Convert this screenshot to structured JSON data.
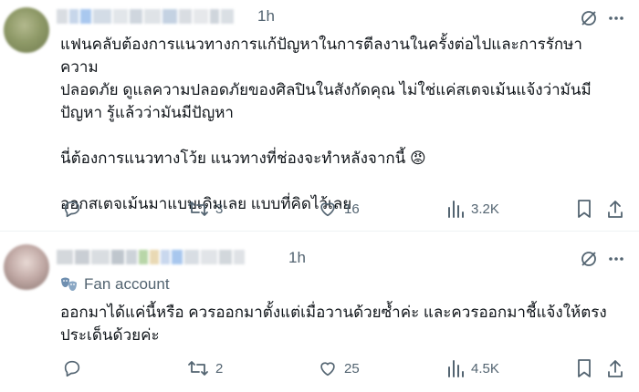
{
  "tweets": [
    {
      "time": "1h",
      "text": "แฟนคลับต้องการแนวทางการแก้ปัญหาในการตีลงานในครั้งต่อไปและการรักษาความ\nปลอดภัย ดูแลความปลอดภัยของศิลปินในสังกัดคุณ ไม่ใช่แค่สเตจเม้นแจ้งว่ามันมี\nปัญหา รู้แล้วว่ามันมีปัญหา\n\nนี่ต้องการแนวทางโว้ย แนวทางที่ช่องจะทำหลังจากนี้ 😡\n\nออกสเตจเม้นมาแบบเดิมเลย แบบที่คิดไว้เลย",
      "stats": {
        "replies": "",
        "reposts": "3",
        "likes": "16",
        "views": "3.2K"
      }
    },
    {
      "time": "1h",
      "badge": "Fan account",
      "text": "ออกมาได้แค่นี้หรือ ควรออกมาตั้งแต่เมื่อวานด้วยซ้ำค่ะ และควรออกมาชี้แจ้งให้ตรง\nประเด็นด้วยค่ะ",
      "stats": {
        "replies": "",
        "reposts": "2",
        "likes": "25",
        "views": "4.5K"
      }
    }
  ],
  "icons": [
    "grok-icon",
    "more-icon",
    "reply-icon",
    "repost-icon",
    "like-icon",
    "views-icon",
    "bookmark-icon",
    "share-icon",
    "theater-masks-icon"
  ],
  "colors": {
    "text": "#0f1419",
    "muted": "#536471",
    "divider": "#eff3f4"
  }
}
